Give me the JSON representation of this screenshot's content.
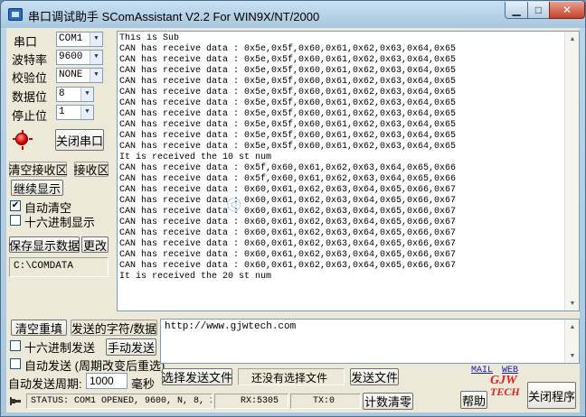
{
  "window": {
    "title": "串口调试助手 SComAssistant V2.2 For WIN9X/NT/2000"
  },
  "settings": {
    "port_label": "串口",
    "port_value": "COM1",
    "baud_label": "波特率",
    "baud_value": "9600",
    "parity_label": "校验位",
    "parity_value": "NONE",
    "databits_label": "数据位",
    "databits_value": "8",
    "stopbits_label": "停止位",
    "stopbits_value": "1"
  },
  "buttons": {
    "close_port": "关闭串口",
    "clear_receive": "清空接收区",
    "receive_area": "接收区",
    "stop_display": "继续显示",
    "save_display": "保存显示数据",
    "change": "更改",
    "clear_resend": "清空重填",
    "send_chars": "发送的字符/数据",
    "manual_send": "手动发送",
    "select_file": "选择发送文件",
    "send_file": "发送文件",
    "count_clear": "计数清零",
    "help": "帮助",
    "close_app": "关闭程序"
  },
  "options": {
    "auto_clear": "自动清空",
    "auto_clear_checked": true,
    "hex_display": "十六进制显示",
    "hex_display_checked": false,
    "hex_send": "十六进制发送",
    "hex_send_checked": false,
    "auto_send": "自动发送 (周期改变后重选)",
    "auto_send_checked": false,
    "period_label": "自动发送周期:",
    "period_value": "1000",
    "period_unit": "毫秒",
    "no_file": "还没有选择文件"
  },
  "save_path": "C:\\COMDATA",
  "receive_lines": [
    "This is Sub",
    "CAN has receive data : 0x5e,0x5f,0x60,0x61,0x62,0x63,0x64,0x65",
    "CAN has receive data : 0x5e,0x5f,0x60,0x61,0x62,0x63,0x64,0x65",
    "CAN has receive data : 0x5e,0x5f,0x60,0x61,0x62,0x63,0x64,0x65",
    "CAN has receive data : 0x5e,0x5f,0x60,0x61,0x62,0x63,0x64,0x65",
    "CAN has receive data : 0x5e,0x5f,0x60,0x61,0x62,0x63,0x64,0x65",
    "CAN has receive data : 0x5e,0x5f,0x60,0x61,0x62,0x63,0x64,0x65",
    "CAN has receive data : 0x5e,0x5f,0x60,0x61,0x62,0x63,0x64,0x65",
    "CAN has receive data : 0x5e,0x5f,0x60,0x61,0x62,0x63,0x64,0x65",
    "CAN has receive data : 0x5e,0x5f,0x60,0x61,0x62,0x63,0x64,0x65",
    "CAN has receive data : 0x5e,0x5f,0x60,0x61,0x62,0x63,0x64,0x65",
    "It is received the 10 st num",
    "CAN has receive data : 0x5f,0x60,0x61,0x62,0x63,0x64,0x65,0x66",
    "CAN has receive data : 0x5f,0x60,0x61,0x62,0x63,0x64,0x65,0x66",
    "CAN has receive data : 0x60,0x61,0x62,0x63,0x64,0x65,0x66,0x67",
    "CAN has receive data : 0x60,0x61,0x62,0x63,0x64,0x65,0x66,0x67",
    "CAN has receive data : 0x60,0x61,0x62,0x63,0x64,0x65,0x66,0x67",
    "CAN has receive data : 0x60,0x61,0x62,0x63,0x64,0x65,0x66,0x67",
    "CAN has receive data : 0x60,0x61,0x62,0x63,0x64,0x65,0x66,0x67",
    "CAN has receive data : 0x60,0x61,0x62,0x63,0x64,0x65,0x66,0x67",
    "CAN has receive data : 0x60,0x61,0x62,0x63,0x64,0x65,0x66,0x67",
    "CAN has receive data : 0x60,0x61,0x62,0x63,0x64,0x65,0x66,0x67",
    "It is received the 20 st num"
  ],
  "send_text": "http://www.gjwtech.com",
  "status": {
    "port": "STATUS: COM1 OPENED, 9600, N, 8, 1",
    "rx": "RX:5305",
    "tx": "TX:0"
  },
  "links": {
    "mail": "MAIL",
    "web": "WEB"
  },
  "logo": {
    "line1": "GJW",
    "line2": "TECH"
  },
  "colors": {
    "titlebar": "#b3cfe6",
    "panel": "#ece9d8",
    "led": "#e00000",
    "link": "#1a1aa8"
  }
}
